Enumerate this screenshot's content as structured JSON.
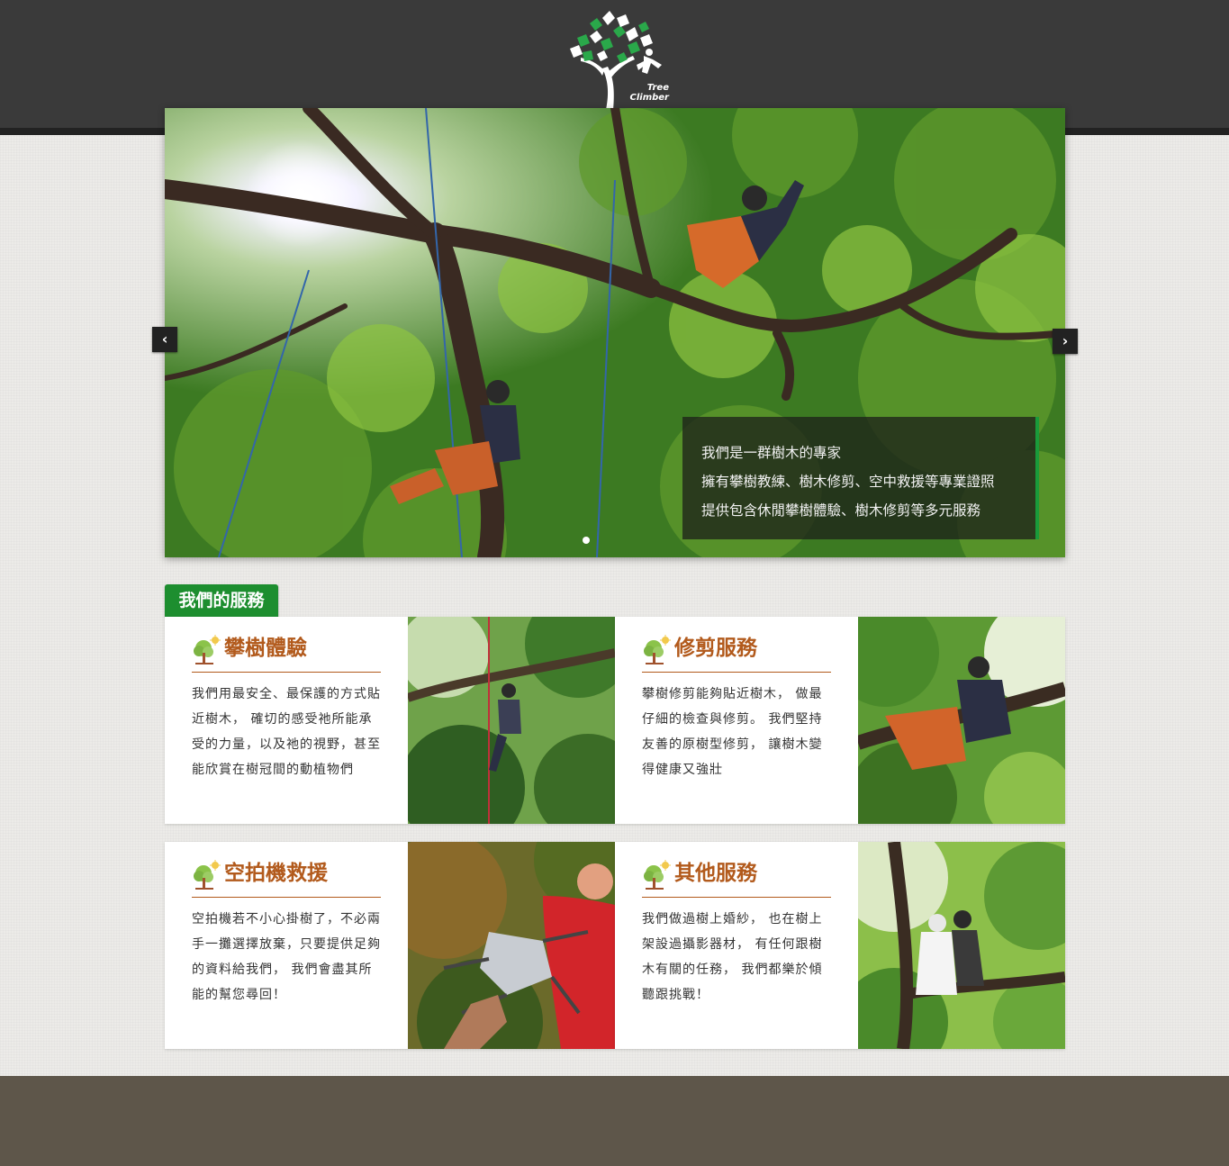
{
  "header": {
    "logo_text_line1": "Tree",
    "logo_text_line2": "Climber",
    "logo_icon": "tree-climber-logo"
  },
  "slider": {
    "prev_label": "‹",
    "next_label": "›",
    "caption": [
      "我們是一群樹木的專家",
      "擁有攀樹教練、樹木修剪、空中救援等專業證照",
      "提供包含休閒攀樹體驗、樹木修剪等多元服務"
    ],
    "accent_color": "#1a9a3a"
  },
  "services": {
    "tab_label": "我們的服務",
    "tab_color": "#1d8e2f",
    "title_color": "#b25a1c",
    "cards": [
      {
        "title": "攀樹體驗",
        "body": "我們用最安全、最保護的方式貼近樹木， 確切的感受祂所能承受的力量，以及祂的視野，甚至能欣賞在樹冠間的動植物們",
        "icon": "tree-icon"
      },
      {
        "title": "修剪服務",
        "body": "攀樹修剪能夠貼近樹木， 做最仔細的檢查與修剪。 我們堅持友善的原樹型修剪， 讓樹木變得健康又強壯",
        "icon": "tree-icon"
      },
      {
        "title": "空拍機救援",
        "body": "空拍機若不小心掛樹了，不必兩手一攤選擇放棄，只要提供足夠的資料給我們， 我們會盡其所能的幫您尋回！",
        "icon": "tree-icon"
      },
      {
        "title": "其他服務",
        "body": "我們做過樹上婚紗， 也在樹上架設過攝影器材， 有任何跟樹木有關的任務， 我們都樂於傾聽跟挑戰！",
        "icon": "tree-icon"
      }
    ]
  }
}
